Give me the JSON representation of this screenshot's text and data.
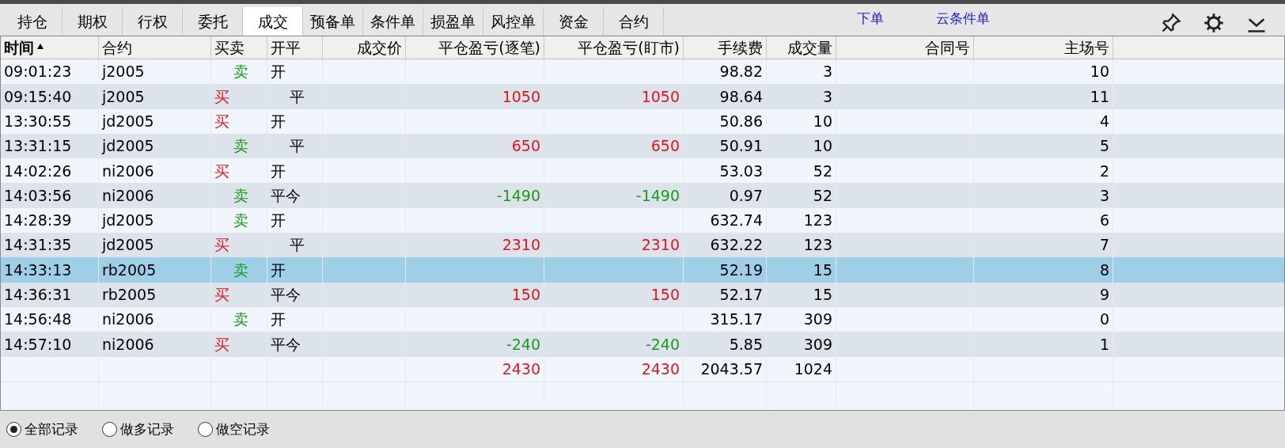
{
  "tabs": [
    {
      "label": "持仓",
      "selected": false
    },
    {
      "label": "期权",
      "selected": false
    },
    {
      "label": "行权",
      "selected": false
    },
    {
      "label": "委托",
      "selected": false
    },
    {
      "label": "成交",
      "selected": true
    },
    {
      "label": "预备单",
      "selected": false
    },
    {
      "label": "条件单",
      "selected": false
    },
    {
      "label": "损盈单",
      "selected": false
    },
    {
      "label": "风控单",
      "selected": false
    },
    {
      "label": "资金",
      "selected": false
    },
    {
      "label": "合约",
      "selected": false
    }
  ],
  "links": [
    "下单",
    "云条件单"
  ],
  "table": {
    "columns": [
      {
        "label": "时间",
        "sorted": true
      },
      {
        "label": "合约",
        "sorted": false
      },
      {
        "label": "买卖",
        "sorted": false
      },
      {
        "label": "开平",
        "sorted": false
      },
      {
        "label": "成交价",
        "sorted": false
      },
      {
        "label": "平仓盈亏(逐笔)",
        "sorted": false
      },
      {
        "label": "平仓盈亏(盯市)",
        "sorted": false
      },
      {
        "label": "手续费",
        "sorted": false
      },
      {
        "label": "成交量",
        "sorted": false
      },
      {
        "label": "合同号",
        "sorted": false
      },
      {
        "label": "主场号",
        "sorted": false
      }
    ],
    "rows": [
      {
        "time": "09:01:23",
        "contract": "j2005",
        "side": "卖",
        "sell": true,
        "offset": "开",
        "offset_indent": false,
        "fee": "98.82",
        "volume": "3",
        "seat": "10",
        "selected": false
      },
      {
        "time": "09:15:40",
        "contract": "j2005",
        "side": "买",
        "sell": false,
        "offset": "平",
        "offset_indent": true,
        "pl": {
          "trade": "1050",
          "mark": "1050",
          "loss": false
        },
        "fee": "98.64",
        "volume": "3",
        "seat": "11",
        "selected": false
      },
      {
        "time": "13:30:55",
        "contract": "jd2005",
        "side": "买",
        "sell": false,
        "offset": "开",
        "offset_indent": false,
        "fee": "50.86",
        "volume": "10",
        "seat": "4",
        "selected": false
      },
      {
        "time": "13:31:15",
        "contract": "jd2005",
        "side": "卖",
        "sell": true,
        "offset": "平",
        "offset_indent": true,
        "pl": {
          "trade": "650",
          "mark": "650",
          "loss": false
        },
        "fee": "50.91",
        "volume": "10",
        "seat": "5",
        "selected": false
      },
      {
        "time": "14:02:26",
        "contract": "ni2006",
        "side": "买",
        "sell": false,
        "offset": "开",
        "offset_indent": false,
        "fee": "53.03",
        "volume": "52",
        "seat": "2",
        "selected": false
      },
      {
        "time": "14:03:56",
        "contract": "ni2006",
        "side": "卖",
        "sell": true,
        "offset": "平今",
        "offset_indent": false,
        "pl": {
          "trade": "-1490",
          "mark": "-1490",
          "loss": true
        },
        "fee": "0.97",
        "volume": "52",
        "seat": "3",
        "selected": false
      },
      {
        "time": "14:28:39",
        "contract": "jd2005",
        "side": "卖",
        "sell": true,
        "offset": "开",
        "offset_indent": false,
        "fee": "632.74",
        "volume": "123",
        "seat": "6",
        "selected": false
      },
      {
        "time": "14:31:35",
        "contract": "jd2005",
        "side": "买",
        "sell": false,
        "offset": "平",
        "offset_indent": true,
        "pl": {
          "trade": "2310",
          "mark": "2310",
          "loss": false
        },
        "fee": "632.22",
        "volume": "123",
        "seat": "7",
        "selected": false
      },
      {
        "time": "14:33:13",
        "contract": "rb2005",
        "side": "卖",
        "sell": true,
        "offset": "开",
        "offset_indent": false,
        "fee": "52.19",
        "volume": "15",
        "seat": "8",
        "selected": true
      },
      {
        "time": "14:36:31",
        "contract": "rb2005",
        "side": "买",
        "sell": false,
        "offset": "平今",
        "offset_indent": false,
        "pl": {
          "trade": "150",
          "mark": "150",
          "loss": false
        },
        "fee": "52.17",
        "volume": "15",
        "seat": "9",
        "selected": false
      },
      {
        "time": "14:56:48",
        "contract": "ni2006",
        "side": "卖",
        "sell": true,
        "offset": "开",
        "offset_indent": false,
        "fee": "315.17",
        "volume": "309",
        "seat": "0",
        "selected": false
      },
      {
        "time": "14:57:10",
        "contract": "ni2006",
        "side": "买",
        "sell": false,
        "offset": "平今",
        "offset_indent": false,
        "pl": {
          "trade": "-240",
          "mark": "-240",
          "loss": true
        },
        "fee": "5.85",
        "volume": "309",
        "seat": "1",
        "selected": false
      }
    ],
    "total": {
      "pl": {
        "trade": "2430",
        "mark": "2430",
        "loss": false
      },
      "fee": "2043.57",
      "volume": "1024"
    }
  },
  "filters": [
    {
      "label": "全部记录",
      "selected": true
    },
    {
      "label": "做多记录",
      "selected": false
    },
    {
      "label": "做空记录",
      "selected": false
    }
  ]
}
